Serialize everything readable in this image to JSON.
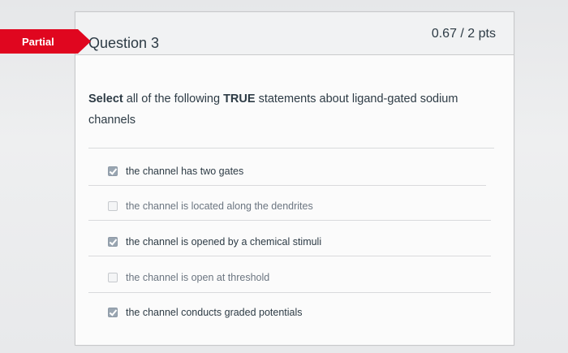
{
  "badge": {
    "label": "Partial",
    "color": "#e0061f"
  },
  "question": {
    "title": "Question 3",
    "points": "0.67 / 2 pts",
    "prompt_select": "Select",
    "prompt_all": "all",
    "prompt_mid": " of the following ",
    "prompt_true": "TRUE",
    "prompt_rest": " statements about ligand-gated sodium channels"
  },
  "answers": [
    {
      "label": "the channel has two gates",
      "checked": true
    },
    {
      "label": "the channel is located along the dendrites",
      "checked": false
    },
    {
      "label": "the channel is opened by a chemical stimuli",
      "checked": true
    },
    {
      "label": "the channel is open at threshold",
      "checked": false
    },
    {
      "label": "the channel conducts graded potentials",
      "checked": true
    }
  ]
}
